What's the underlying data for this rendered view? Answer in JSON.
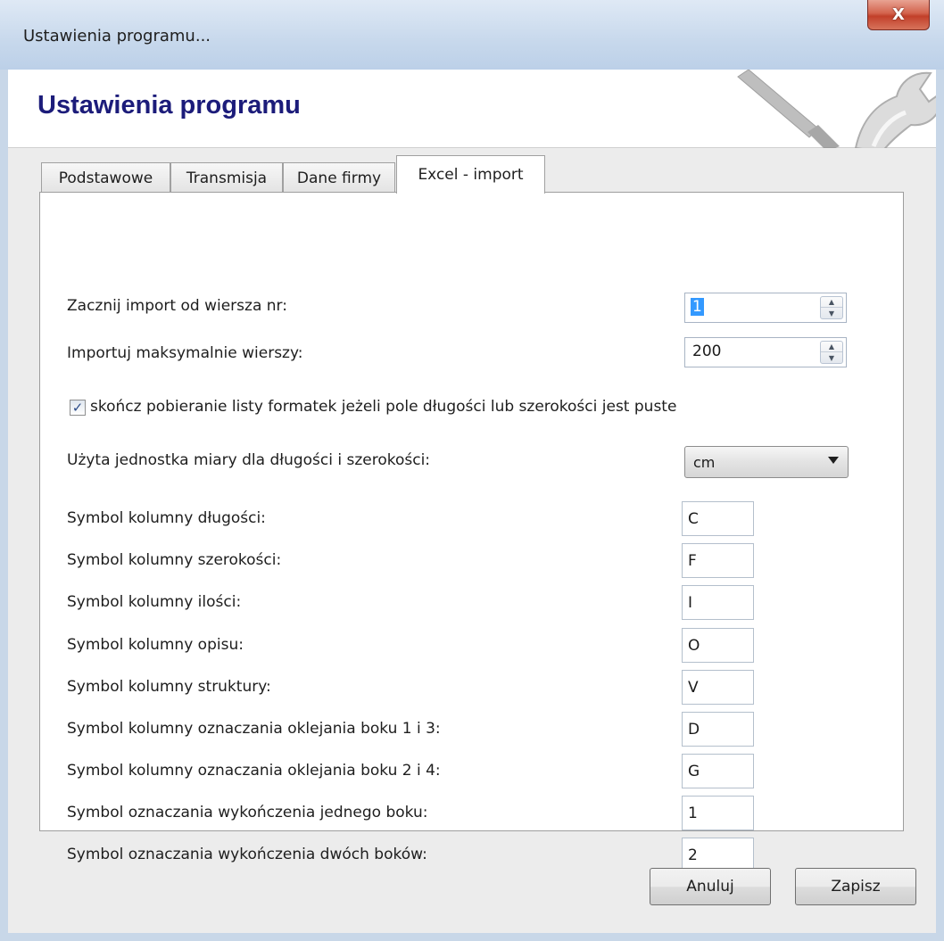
{
  "window": {
    "title": "Ustawienia programu...",
    "close_label": "X"
  },
  "header": {
    "title": "Ustawienia programu",
    "icon": "tools-icon"
  },
  "tabs": [
    {
      "label": "Podstawowe",
      "active": false
    },
    {
      "label": "Transmisja",
      "active": false
    },
    {
      "label": "Dane firmy",
      "active": false
    },
    {
      "label": "Excel - import",
      "active": true
    }
  ],
  "import": {
    "start_row_label": "Zacznij import od wiersza nr:",
    "start_row_value": "1",
    "max_rows_label": "Importuj maksymalnie wierszy:",
    "max_rows_value": "200",
    "stop_checkbox_label": "skończ pobieranie listy formatek jeżeli pole długości lub szerokości jest puste",
    "stop_checkbox_checked": true,
    "unit_label": "Użyta jednostka miary dla długości  i szerokości:",
    "unit_value": "cm"
  },
  "symbols": [
    {
      "label": "Symbol kolumny długości:",
      "value": "C"
    },
    {
      "label": "Symbol kolumny szerokości:",
      "value": "F"
    },
    {
      "label": "Symbol kolumny ilości:",
      "value": "I"
    },
    {
      "label": "Symbol kolumny opisu:",
      "value": "O"
    },
    {
      "label": "Symbol kolumny struktury:",
      "value": "V"
    },
    {
      "label": "Symbol kolumny oznaczania oklejania boku 1 i 3:",
      "value": "D"
    },
    {
      "label": "Symbol kolumny oznaczania oklejania boku 2 i 4:",
      "value": "G"
    },
    {
      "label": "Symbol oznaczania wykończenia jednego boku:",
      "value": "1"
    },
    {
      "label": "Symbol oznaczania wykończenia dwóch boków:",
      "value": "2"
    }
  ],
  "buttons": {
    "cancel": "Anuluj",
    "save": "Zapisz"
  }
}
